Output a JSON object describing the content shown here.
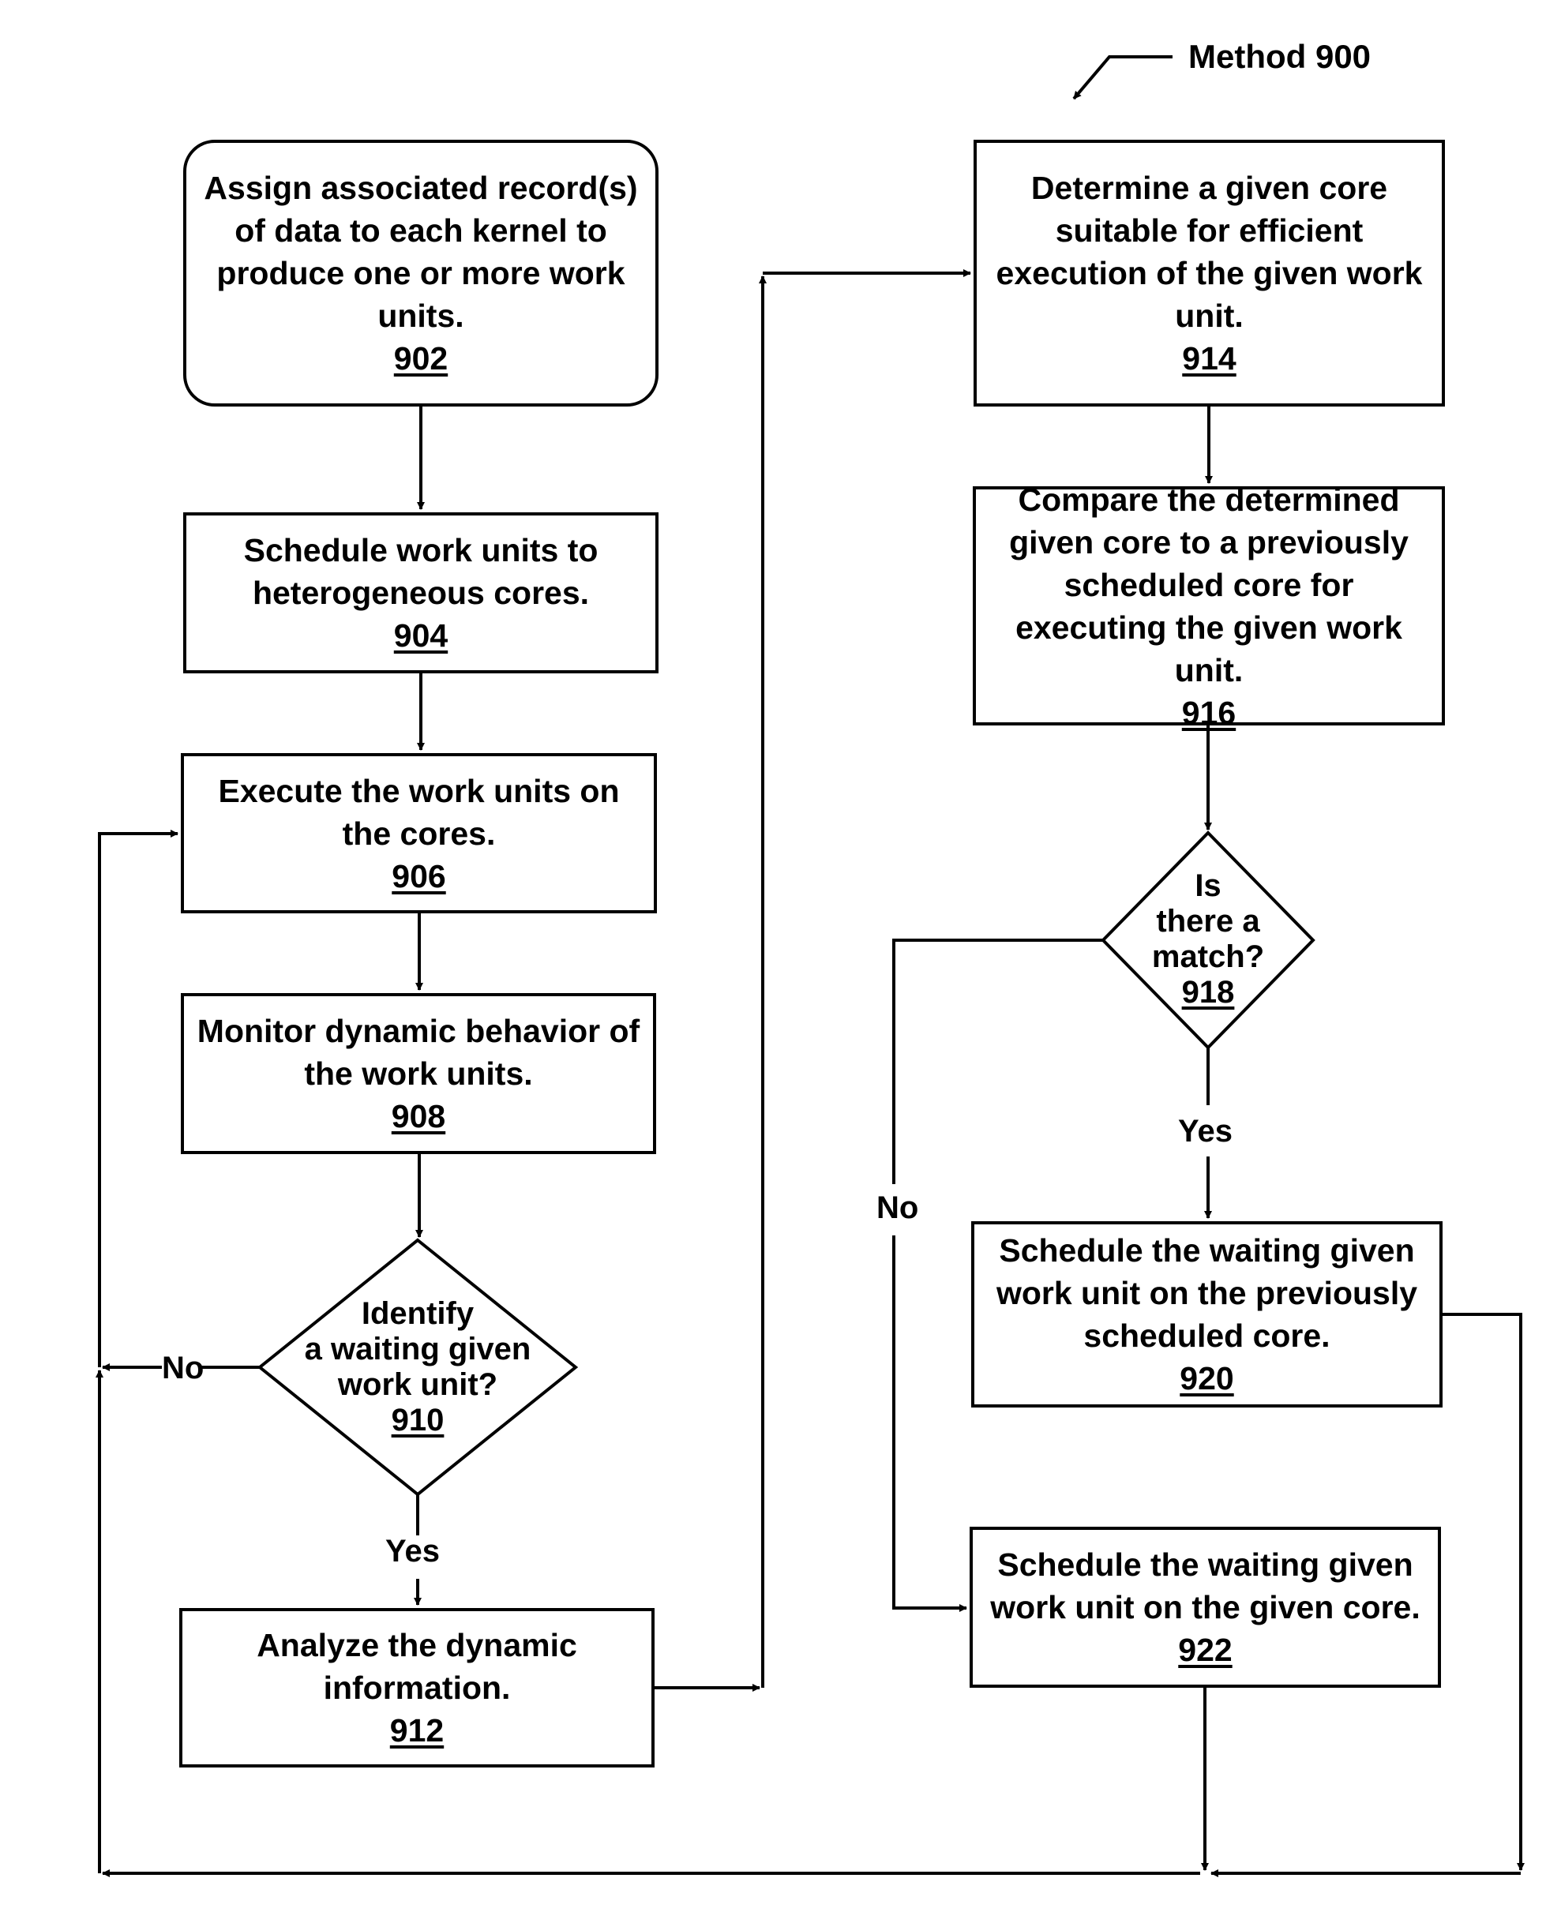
{
  "title": "Method 900",
  "nodes": {
    "n902": {
      "text": "Assign associated record(s) of data to each kernel to produce one or more work units.",
      "ref": "902"
    },
    "n904": {
      "text": "Schedule work units to heterogeneous cores.",
      "ref": "904"
    },
    "n906": {
      "text": "Execute the work units on the cores.",
      "ref": "906"
    },
    "n908": {
      "text": "Monitor dynamic behavior of the work units.",
      "ref": "908"
    },
    "n910": {
      "line1": "Identify",
      "line2": "a waiting given",
      "line3": "work unit?",
      "ref": "910"
    },
    "n912": {
      "text": "Analyze the dynamic information.",
      "ref": "912"
    },
    "n914": {
      "text": "Determine a given core suitable for efficient execution of the given work unit.",
      "ref": "914"
    },
    "n916": {
      "text": "Compare the determined given core to a previously scheduled core for executing the given work unit.",
      "ref": "916"
    },
    "n918": {
      "line1": "Is",
      "line2": "there a",
      "line3": "match?",
      "ref": "918"
    },
    "n920": {
      "text": "Schedule the waiting given work unit on the previously scheduled core.",
      "ref": "920"
    },
    "n922": {
      "text": "Schedule the waiting given work unit on the given core.",
      "ref": "922"
    }
  },
  "edge_labels": {
    "d910_no": "No",
    "d910_yes": "Yes",
    "d918_no": "No",
    "d918_yes": "Yes"
  }
}
